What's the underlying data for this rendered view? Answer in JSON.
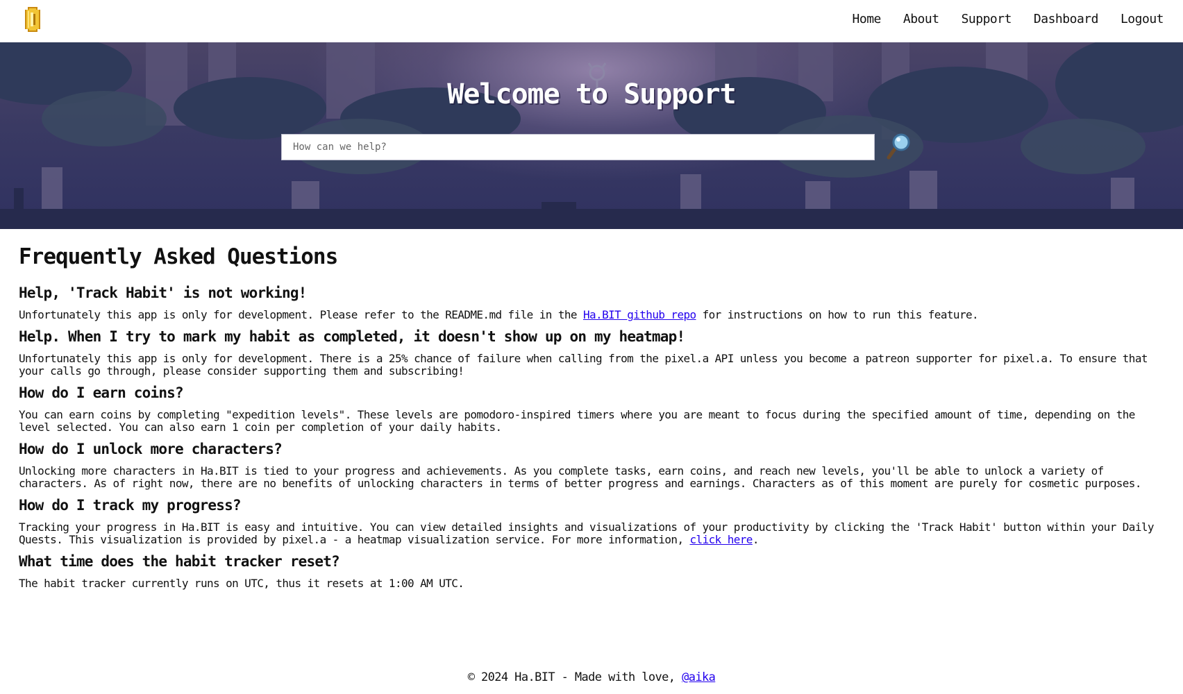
{
  "nav": {
    "logo_icon": "gold-coin-icon",
    "links": [
      "Home",
      "About",
      "Support",
      "Dashboard",
      "Logout"
    ]
  },
  "hero": {
    "title": "Welcome to Support",
    "search_placeholder": "How can we help?",
    "search_icon": "magnifying-glass-icon"
  },
  "faq": {
    "title": "Frequently Asked Questions",
    "items": [
      {
        "question": "Help, 'Track Habit' is not working!",
        "answer_pre": "Unfortunately this app is only for development. Please refer to the README.md file in the ",
        "link": "Ha.BIT github repo",
        "answer_post": " for instructions on how to run this feature."
      },
      {
        "question": "Help. When I try to mark my habit as completed, it doesn't show up on my heatmap!",
        "answer": "Unfortunately this app is only for development. There is a 25% chance of failure when calling from the pixel.a API unless you become a patreon supporter for pixel.a. To ensure that your calls go through, please consider supporting them and subscribing!"
      },
      {
        "question": "How do I earn coins?",
        "answer": "You can earn coins by completing \"expedition levels\". These levels are pomodoro-inspired timers where you are meant to focus during the specified amount of time, depending on the level selected. You can also earn 1 coin per completion of your daily habits."
      },
      {
        "question": "How do I unlock more characters?",
        "answer": "Unlocking more characters in Ha.BIT is tied to your progress and achievements. As you complete tasks, earn coins, and reach new levels, you'll be able to unlock a variety of characters. As of right now, there are no benefits of unlocking characters in terms of better progress and earnings. Characters as of this moment are purely for cosmetic purposes."
      },
      {
        "question": "How do I track my progress?",
        "answer_pre": "Tracking your progress in Ha.BIT is easy and intuitive. You can view detailed insights and visualizations of your productivity by clicking the 'Track Habit' button within your Daily Quests. This visualization is provided by pixel.a - a heatmap visualization service. For more information, ",
        "link": "click here",
        "answer_post": "."
      },
      {
        "question": "What time does the habit tracker reset?",
        "answer": "The habit tracker currently runs on UTC, thus it resets at 1:00 AM UTC."
      }
    ]
  },
  "footer": {
    "text": "© 2024 Ha.BIT - Made with love, ",
    "link": "@aika"
  },
  "colors": {
    "link": "#2200ee",
    "hero_bg": "#3a3a63",
    "coin": "#e8b923"
  }
}
